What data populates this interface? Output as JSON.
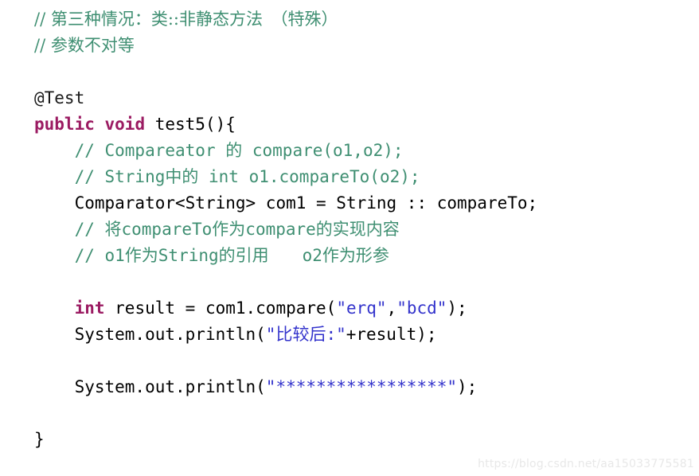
{
  "editor": {
    "language": "java",
    "background_color": "#ffffff",
    "colors": {
      "comment": "#3f8f72",
      "keyword": "#9b1b62",
      "string": "#3333cc",
      "plain": "#000000",
      "annotation": "#1a1a1a",
      "watermark": "#e8e8e8"
    }
  },
  "lines": [
    {
      "id": "line-1",
      "indent": "",
      "kind": "comment",
      "text": "// 第三种情况：类::非静态方法　（特殊）"
    },
    {
      "id": "line-2",
      "indent": "",
      "kind": "comment",
      "text": "// 参数不对等"
    },
    {
      "id": "line-3",
      "indent": "",
      "kind": "blank",
      "text": ""
    },
    {
      "id": "line-4",
      "indent": "",
      "kind": "annotation",
      "text": "@Test"
    },
    {
      "id": "line-5",
      "indent": "",
      "kind": "code",
      "keyword1": "public",
      "keyword2": "void",
      "rest": " test5(){",
      "space": " "
    },
    {
      "id": "line-6",
      "indent": "    ",
      "kind": "comment",
      "text": "// Compareator 的 compare(o1,o2);"
    },
    {
      "id": "line-7",
      "indent": "    ",
      "kind": "comment",
      "text": "// String中的 int o1.compareTo(o2);"
    },
    {
      "id": "line-8",
      "indent": "    ",
      "kind": "plain",
      "text": "Comparator<String> com1 = String :: compareTo;"
    },
    {
      "id": "line-9",
      "indent": "    ",
      "kind": "comment",
      "text": "// 将compareTo作为compare的实现内容"
    },
    {
      "id": "line-10",
      "indent": "    ",
      "kind": "comment",
      "text": "// o1作为String的引用　　o2作为形参"
    },
    {
      "id": "line-11",
      "indent": "",
      "kind": "blank",
      "text": ""
    },
    {
      "id": "line-12",
      "indent": "    ",
      "kind": "code-int",
      "keyword": "int",
      "before": " result = com1.compare(",
      "string1": "\"erq\"",
      "comma": ",",
      "string2": "\"bcd\"",
      "after": ");"
    },
    {
      "id": "line-13",
      "indent": "    ",
      "kind": "code-print",
      "before": "System.out.println(",
      "string": "\"比较后:\"",
      "after": "+result);"
    },
    {
      "id": "line-14",
      "indent": "",
      "kind": "blank",
      "text": ""
    },
    {
      "id": "line-15",
      "indent": "    ",
      "kind": "code-print",
      "before": "System.out.println(",
      "string": "\"*****************\"",
      "after": ");"
    },
    {
      "id": "line-16",
      "indent": "",
      "kind": "blank",
      "text": ""
    },
    {
      "id": "line-17",
      "indent": "",
      "kind": "plain",
      "text": "}"
    }
  ],
  "watermark": {
    "text": "https://blog.csdn.net/aa15033775581"
  }
}
